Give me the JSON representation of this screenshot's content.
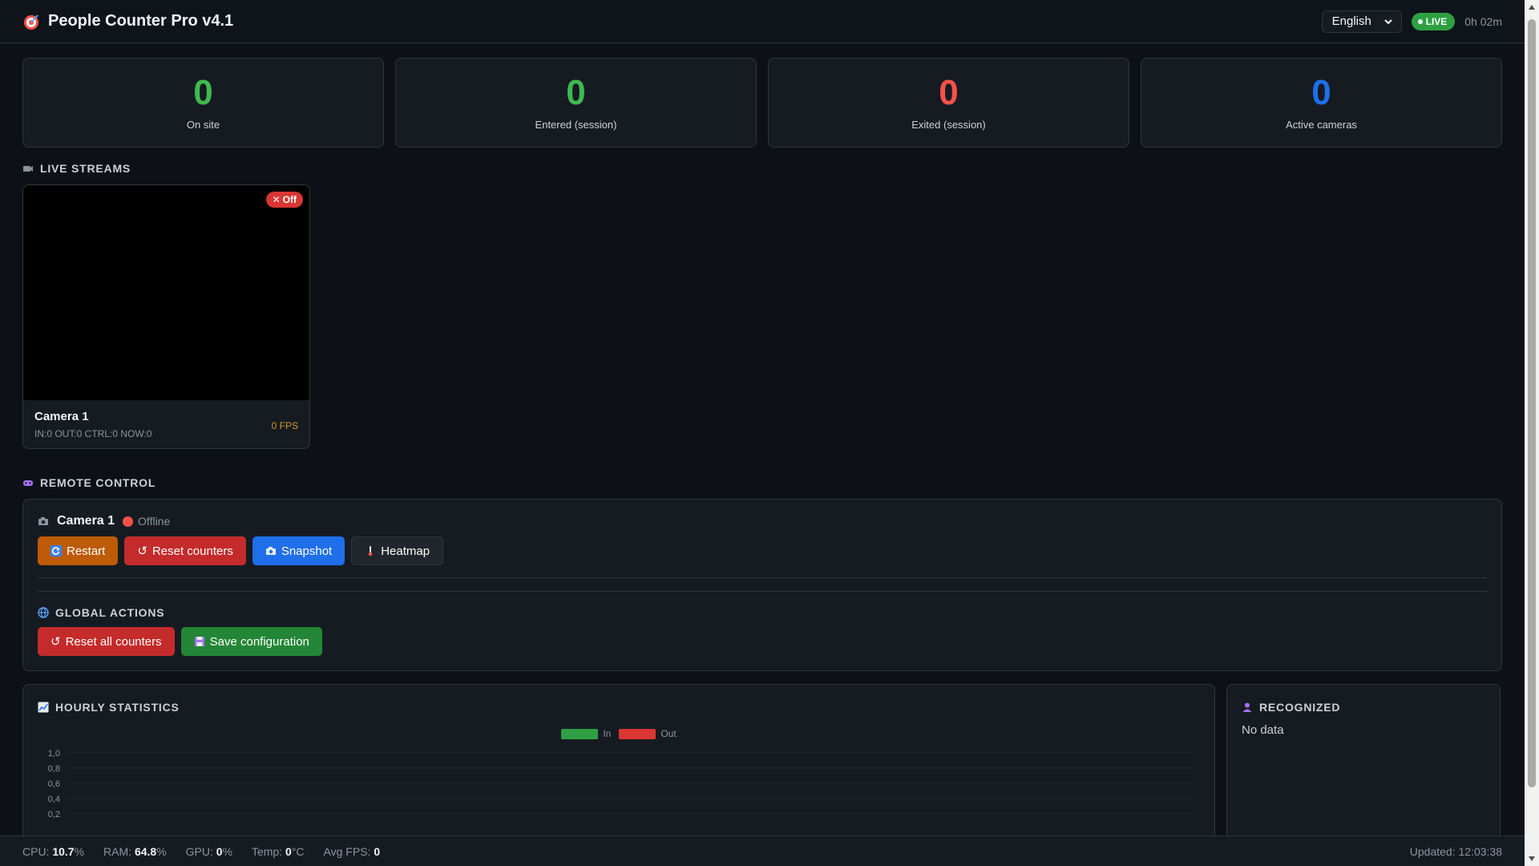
{
  "app": {
    "title": "People Counter Pro v4.1"
  },
  "header": {
    "language": "English",
    "live_label": "LIVE",
    "uptime": "0h 02m"
  },
  "stats": [
    {
      "value": "0",
      "label": "On site",
      "color": "#3fb950"
    },
    {
      "value": "0",
      "label": "Entered (session)",
      "color": "#3fb950"
    },
    {
      "value": "0",
      "label": "Exited (session)",
      "color": "#f85149"
    },
    {
      "value": "0",
      "label": "Active cameras",
      "color": "#1f6feb"
    }
  ],
  "streams": {
    "title": "LIVE STREAMS",
    "cameras": [
      {
        "name": "Camera 1",
        "status_badge": "Off",
        "meta": "IN:0 OUT:0 CTRL:0 NOW:0",
        "fps": "0 FPS"
      }
    ]
  },
  "remote": {
    "title": "REMOTE CONTROL",
    "camera_name": "Camera 1",
    "camera_status": "Offline",
    "buttons": {
      "restart": "Restart",
      "reset": "Reset counters",
      "snapshot": "Snapshot",
      "heatmap": "Heatmap"
    },
    "global_title": "GLOBAL ACTIONS",
    "global_buttons": {
      "reset_all": "Reset all counters",
      "save": "Save configuration"
    }
  },
  "hourly": {
    "title": "HOURLY STATISTICS"
  },
  "recognized": {
    "title": "RECOGNIZED",
    "empty": "No data"
  },
  "chart_data": {
    "type": "bar",
    "categories": [],
    "series": [
      {
        "name": "In",
        "values": [],
        "color": "#2ea043"
      },
      {
        "name": "Out",
        "values": [],
        "color": "#da3633"
      }
    ],
    "y_ticks": [
      "1,0",
      "0,8",
      "0,6",
      "0,4",
      "0,2"
    ],
    "ylim": [
      0,
      1
    ],
    "legend_position": "top-center",
    "grid": true
  },
  "footer": {
    "cpu_label": "CPU:",
    "cpu": "10.7",
    "cpu_unit": "%",
    "ram_label": "RAM:",
    "ram": "64.8",
    "ram_unit": "%",
    "gpu_label": "GPU:",
    "gpu": "0",
    "gpu_unit": "%",
    "temp_label": "Temp:",
    "temp": "0",
    "temp_unit": "°C",
    "fps_label": "Avg FPS:",
    "fps": "0",
    "updated": "Updated: 12:03:38"
  }
}
